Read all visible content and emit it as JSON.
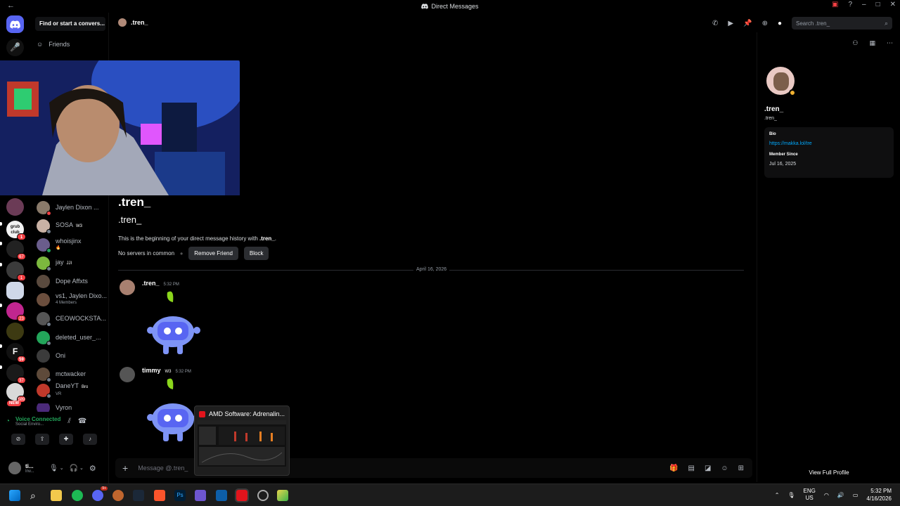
{
  "titlebar": {
    "title": "Direct Messages"
  },
  "dm_column": {
    "find_placeholder": "Find or start a convers...",
    "friends_label": "Friends",
    "dms": [
      {
        "name": "Jaylen Dixon ...",
        "tag": ""
      },
      {
        "name": "SOSA",
        "tag": "W3"
      },
      {
        "name": "whoisjinx",
        "tag": ""
      },
      {
        "name": "jay",
        "tag": "JJI"
      },
      {
        "name": "Dope Affxts",
        "tag": ""
      },
      {
        "name": "vs1, Jaylen Dixo...",
        "sub": "4 Members"
      },
      {
        "name": "CEOWOCKSTA...",
        "tag": ""
      },
      {
        "name": "deleted_user_...",
        "tag": ""
      },
      {
        "name": "Oni",
        "tag": ""
      },
      {
        "name": "mctwacker",
        "tag": ""
      },
      {
        "name": "DaneYT",
        "tag": "Bro",
        "sub": "VR"
      },
      {
        "name": "Vyron",
        "tag": ""
      }
    ]
  },
  "server_badges": [
    "1",
    "67",
    "1",
    "23",
    "59",
    "37",
    "589",
    "NEW"
  ],
  "voice": {
    "status": "Voice Connected",
    "channel": "Social Enviro..."
  },
  "user": {
    "name": "ti...",
    "status": "Inv..."
  },
  "header": {
    "channel": ".tren_",
    "search_placeholder": "Search .tren_"
  },
  "chat": {
    "display_name": ".tren_",
    "username": ".tren_",
    "intro_prefix": "This is the beginning of your direct message history with ",
    "intro_name": ".tren_",
    "no_servers": "No servers in common",
    "remove_friend": "Remove Friend",
    "block": "Block",
    "date_divider": "April 16, 2026",
    "messages": [
      {
        "author": ".tren_",
        "time": "5:32 PM",
        "tag": ""
      },
      {
        "author": "timmy",
        "time": "5:32 PM",
        "tag": "W3"
      }
    ],
    "composer_placeholder": "Message @.tren_"
  },
  "popup": {
    "title": "AMD Software: Adrenalin..."
  },
  "profile": {
    "display_name": ".tren_",
    "username": ".tren_",
    "bio_label": "Bio",
    "bio_link": "https://makka.lol/tre",
    "member_since_label": "Member Since",
    "member_since": "Jul 16, 2025",
    "view_full": "View Full Profile"
  },
  "taskbar": {
    "lang": "ENG",
    "region": "US",
    "time": "5:32 PM",
    "date": "4/16/2026",
    "discord_badge": "9+"
  },
  "colors": {
    "accent": "#5865f2",
    "link": "#00a8fc",
    "bg": "#000000",
    "panel": "#1e1f22"
  }
}
